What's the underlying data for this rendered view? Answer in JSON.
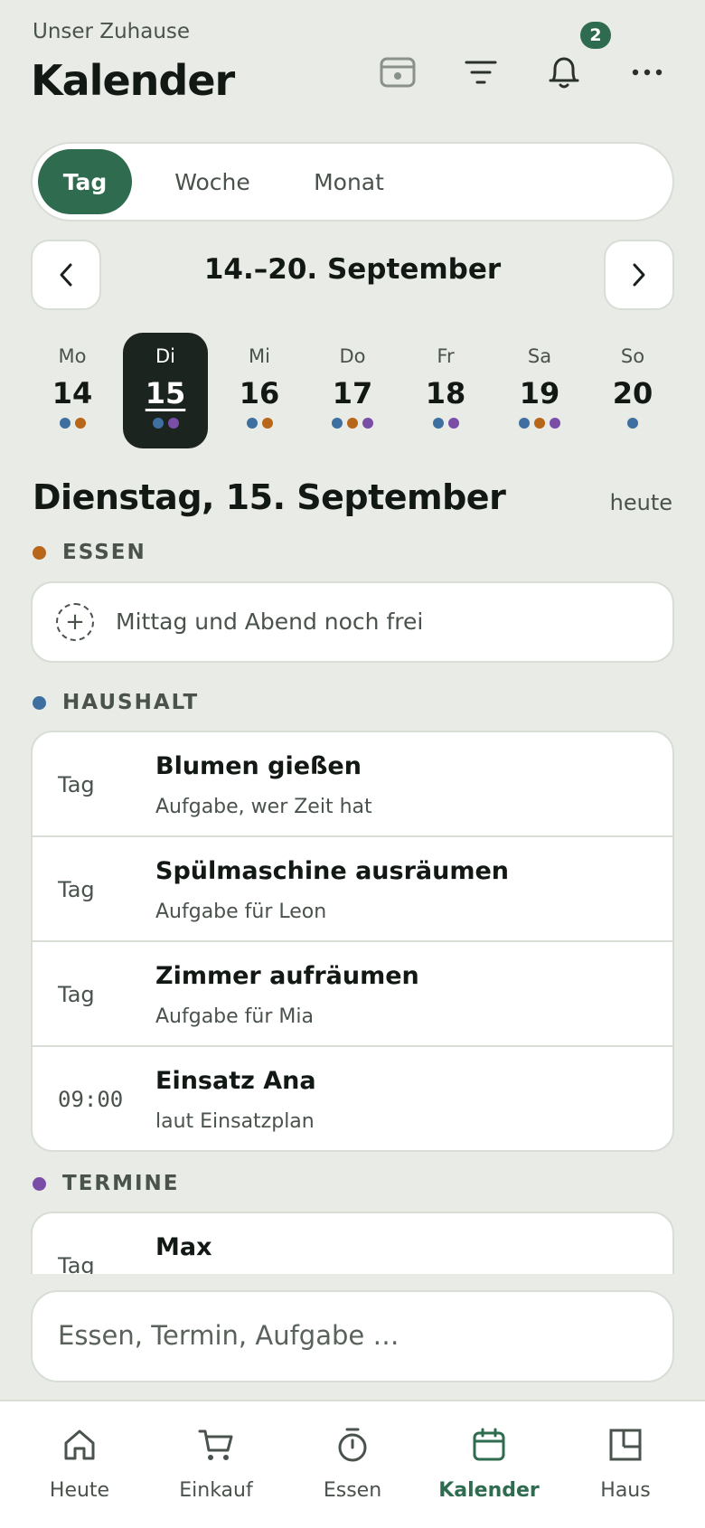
{
  "header": {
    "subtitle": "Unser Zuhause",
    "title": "Kalender",
    "notification_count": "2",
    "icons": [
      "calendar-card-icon",
      "filter-icon",
      "bell-icon",
      "more-icon"
    ]
  },
  "view_switch": {
    "day": "Tag",
    "week": "Woche",
    "month": "Monat",
    "selected": "Tag"
  },
  "week_range": "14.–20. September",
  "days": [
    {
      "name": "Mo",
      "date": "14",
      "dots": [
        "#3f6fa0",
        "#b8661a"
      ]
    },
    {
      "name": "Di",
      "date": "15",
      "dots": [
        "#3f6fa0",
        "#7a4ea6"
      ],
      "selected": true
    },
    {
      "name": "Mi",
      "date": "16",
      "dots": [
        "#3f6fa0",
        "#b8661a"
      ]
    },
    {
      "name": "Do",
      "date": "17",
      "dots": [
        "#3f6fa0",
        "#b8661a",
        "#7a4ea6"
      ]
    },
    {
      "name": "Fr",
      "date": "18",
      "dots": [
        "#3f6fa0",
        "#7a4ea6"
      ]
    },
    {
      "name": "Sa",
      "date": "19",
      "dots": [
        "#3f6fa0",
        "#b8661a",
        "#7a4ea6"
      ]
    },
    {
      "name": "So",
      "date": "20",
      "dots": [
        "#3f6fa0"
      ]
    }
  ],
  "day_heading": "Dienstag, 15. September",
  "today_label": "heute",
  "colors": {
    "accent": "#2e6b4f",
    "essen": "#b8661a",
    "haushalt": "#3f6fa0",
    "termine": "#7a4ea6"
  },
  "sections": {
    "essen": {
      "label": "ESSEN",
      "empty_text": "Mittag und Abend noch frei"
    },
    "haushalt": {
      "label": "HAUSHALT",
      "items": [
        {
          "time": "Tag",
          "title": "Blumen gießen",
          "subtitle": "Aufgabe, wer Zeit hat"
        },
        {
          "time": "Tag",
          "title": "Spülmaschine ausräumen",
          "subtitle": "Aufgabe für Leon"
        },
        {
          "time": "Tag",
          "title": "Zimmer aufräumen",
          "subtitle": "Aufgabe für Mia"
        },
        {
          "time": "09:00",
          "title": "Einsatz Ana",
          "subtitle": "laut Einsatzplan"
        }
      ]
    },
    "termine": {
      "label": "TERMINE",
      "items": [
        {
          "time": "Tag",
          "title": "Max"
        }
      ]
    }
  },
  "quick_add": {
    "placeholder": "Essen, Termin, Aufgabe …"
  },
  "bottom_nav": [
    {
      "label": "Heute",
      "icon": "home-icon"
    },
    {
      "label": "Einkauf",
      "icon": "cart-icon"
    },
    {
      "label": "Essen",
      "icon": "timer-icon"
    },
    {
      "label": "Kalender",
      "icon": "calendar-icon",
      "active": true
    },
    {
      "label": "Haus",
      "icon": "floorplan-icon"
    }
  ]
}
